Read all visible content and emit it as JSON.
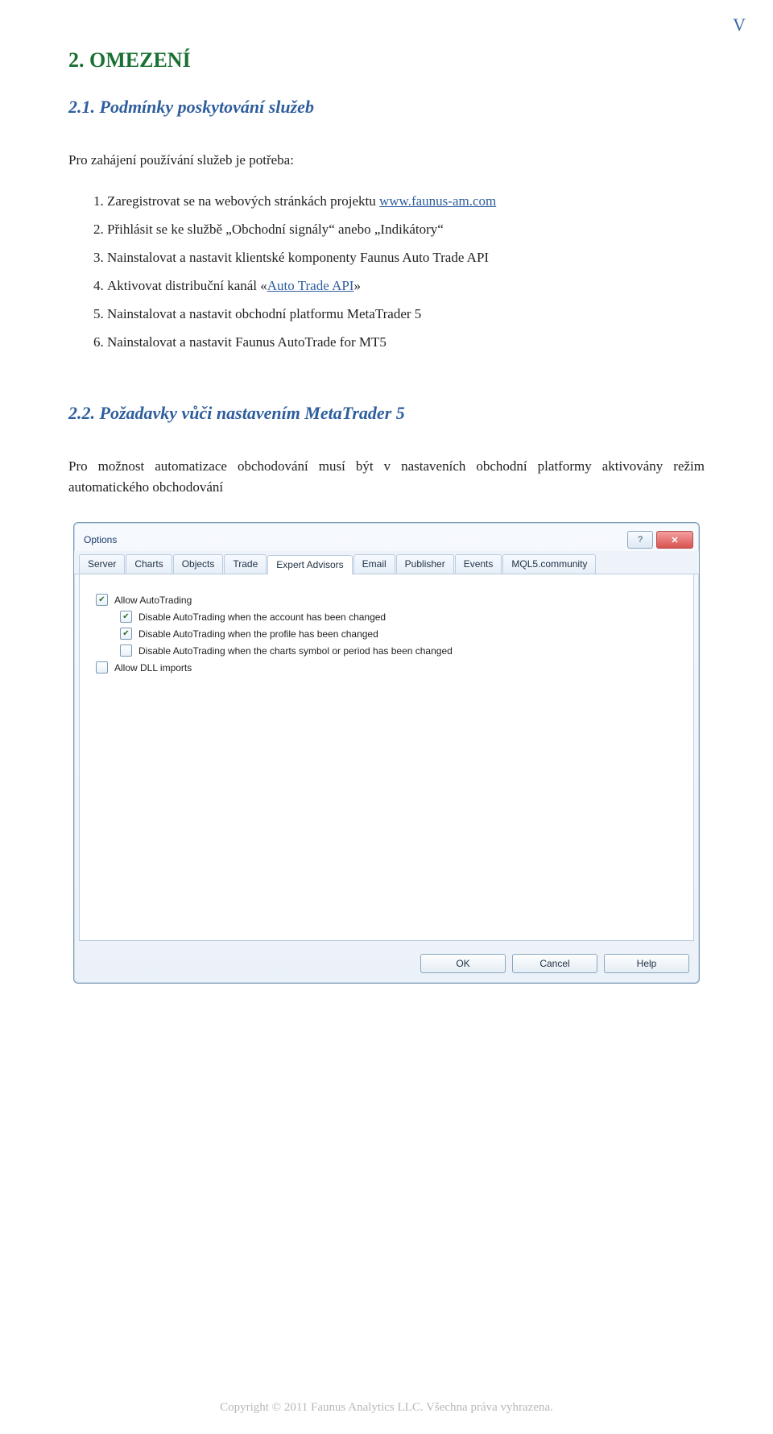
{
  "corner_marker": "V",
  "heading1": "2. OMEZENÍ",
  "sub1_heading": "2.1. Podmínky poskytování služeb",
  "sub1_intro": "Pro zahájení používání služeb je potřeba:",
  "steps": [
    {
      "prefix": "Zaregistrovat se na webových stránkách projektu ",
      "link_text": "www.faunus-am.com"
    },
    {
      "prefix": "Přihlásit se ke službě „Obchodní signály“ anebo „Indikátory“"
    },
    {
      "prefix": "Nainstalovat a nastavit klientské komponenty Faunus Auto Trade API"
    },
    {
      "prefix": "Aktivovat distribuční kanál «",
      "link_text": "Auto Trade API",
      "suffix": "»"
    },
    {
      "prefix": "Nainstalovat a nastavit obchodní platformu  MetaTrader 5"
    },
    {
      "prefix": "Nainstalovat a nastavit Faunus AutoTrade for MT5"
    }
  ],
  "sub2_heading": "2.2. Požadavky vůči nastavením MetaTrader 5",
  "sub2_body": "Pro možnost automatizace obchodování musí být v nastaveních obchodní platformy aktivovány režim automatického obchodování",
  "dialog": {
    "title": "Options",
    "tabs": [
      "Server",
      "Charts",
      "Objects",
      "Trade",
      "Expert Advisors",
      "Email",
      "Publisher",
      "Events",
      "MQL5.community"
    ],
    "active_tab_index": 4,
    "options": [
      {
        "label": "Allow AutoTrading",
        "checked": true,
        "indent": false
      },
      {
        "label": "Disable AutoTrading when the account has been changed",
        "checked": true,
        "indent": true
      },
      {
        "label": "Disable AutoTrading when the profile has been changed",
        "checked": true,
        "indent": true
      },
      {
        "label": "Disable AutoTrading when the charts symbol or period has been changed",
        "checked": false,
        "indent": true
      },
      {
        "label": "Allow DLL imports",
        "checked": false,
        "indent": false
      }
    ],
    "buttons": {
      "ok": "OK",
      "cancel": "Cancel",
      "help": "Help"
    }
  },
  "footer": "Copyright © 2011 Faunus Analytics LLC. Všechna práva vyhrazena."
}
